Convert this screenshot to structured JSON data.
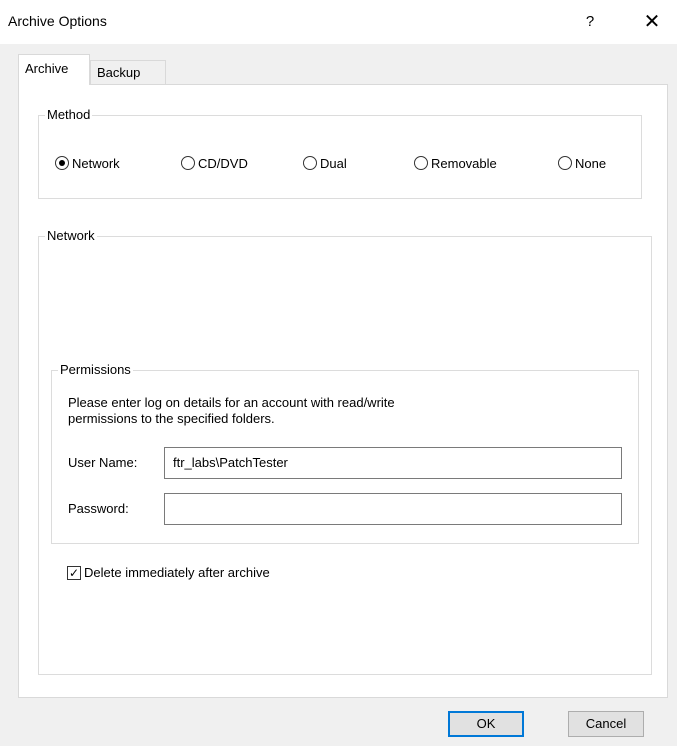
{
  "window": {
    "title": "Archive Options",
    "help_label": "?",
    "close_label": "✕"
  },
  "tabs": [
    {
      "label": "Archive",
      "active": true
    },
    {
      "label": "Backup",
      "active": false
    }
  ],
  "method_group": {
    "legend": "Method",
    "options": [
      {
        "label": "Network",
        "checked": true
      },
      {
        "label": "CD/DVD",
        "checked": false
      },
      {
        "label": "Dual",
        "checked": false
      },
      {
        "label": "Removable",
        "checked": false
      },
      {
        "label": "None",
        "checked": false
      }
    ]
  },
  "network_group": {
    "legend": "Network"
  },
  "permissions_group": {
    "legend": "Permissions",
    "description_line1": "Please enter log on details for an account with read/write",
    "description_line2": "permissions to the specified folders.",
    "username_label": "User Name:",
    "username_value": "ftr_labs\\PatchTester",
    "password_label": "Password:",
    "password_value": ""
  },
  "delete_checkbox": {
    "label": "Delete immediately after archive",
    "checked": true,
    "mark": "✓"
  },
  "buttons": {
    "ok": "OK",
    "cancel": "Cancel"
  },
  "colors": {
    "default_button_border": "#0078d7",
    "dialog_bg": "#f0f0f0"
  }
}
